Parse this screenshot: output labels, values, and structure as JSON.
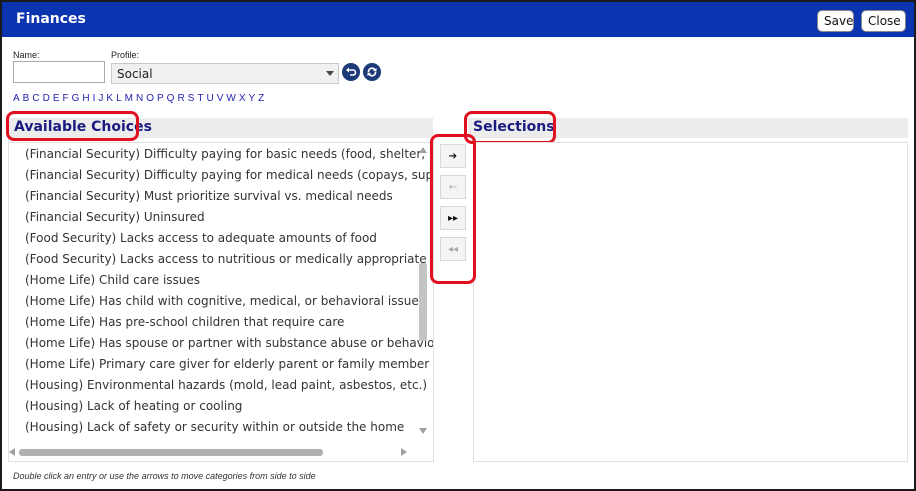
{
  "window": {
    "title": "Finances",
    "save_label": "Save",
    "close_label": "Close"
  },
  "form": {
    "name_label": "Name:",
    "name_value": "",
    "profile_label": "Profile:",
    "profile_value": "Social"
  },
  "alphabet": [
    "A",
    "B",
    "C",
    "D",
    "E",
    "F",
    "G",
    "H",
    "I",
    "J",
    "K",
    "L",
    "M",
    "N",
    "O",
    "P",
    "Q",
    "R",
    "S",
    "T",
    "U",
    "V",
    "W",
    "X",
    "Y",
    "Z"
  ],
  "available": {
    "title": "Available Choices",
    "items": [
      "(Financial Security) Difficulty paying for basic needs (food, shelter, utilities",
      "(Financial Security) Difficulty paying for medical needs (copays, supplies)",
      "(Financial Security) Must prioritize survival vs. medical needs",
      "(Financial Security) Uninsured",
      "(Food Security) Lacks access to adequate amounts of food",
      "(Food Security) Lacks access to nutritious or medically appropriate diet",
      "(Home Life) Child care issues",
      "(Home Life) Has child with cognitive, medical, or behavioral issues",
      "(Home Life) Has pre-school children that require care",
      "(Home Life) Has spouse or partner with substance abuse or behavioral iss",
      "(Home Life) Primary care giver for elderly parent or family member",
      "(Housing) Environmental hazards (mold, lead paint, asbestos, etc.)",
      "(Housing) Lack of heating or cooling",
      "(Housing) Lack of safety or security within or outside the home"
    ]
  },
  "selections": {
    "title": "Selections",
    "items": []
  },
  "arrows": {
    "move_right": "➔",
    "move_left": "←",
    "move_all_right": "▸▸",
    "move_all_left": "◂◂"
  },
  "footer": {
    "note": "Double click an entry or use the arrows to move categories from side to side"
  },
  "colors": {
    "titlebar": "#0a34b0",
    "header_text": "#1a1a80",
    "highlight": "#e01020",
    "alpha_link": "#2323b0"
  }
}
